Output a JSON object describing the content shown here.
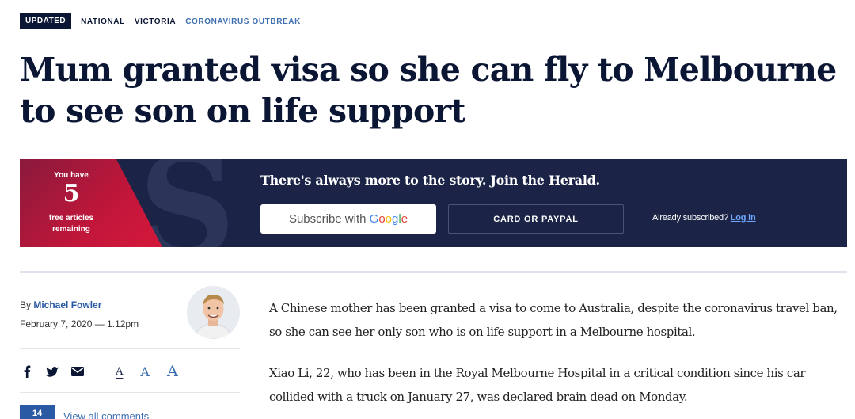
{
  "tags": {
    "updated": "UPDATED",
    "national": "NATIONAL",
    "victoria": "VICTORIA",
    "topic": "CORONAVIRUS OUTBREAK"
  },
  "headline": "Mum granted visa so she can fly to Melbourne to see son on life support",
  "paywall": {
    "you_have": "You have",
    "count": "5",
    "free_articles": "free articles",
    "remaining": "remaining",
    "pitch": "There's always more to the story. Join the Herald.",
    "subscribe_prefix": "Subscribe with ",
    "google_word": "Google",
    "card_button": "CARD OR PAYPAL",
    "already_text": "Already subscribed?",
    "login_link": "Log in"
  },
  "article": {
    "by": "By ",
    "author": "Michael Fowler",
    "date": "February 7, 2020 — 1.12pm",
    "paragraphs": [
      "A Chinese mother has been granted a visa to come to Australia, despite the coronavirus travel ban, so she can see her only son who is on life support in a Melbourne hospital.",
      "Xiao Li, 22, who has been in the Royal Melbourne Hospital in a critical condition since his car collided with a truck on January 27, was declared brain dead on Monday."
    ]
  },
  "tools": {
    "font_small": "A",
    "font_medium": "A",
    "font_large": "A",
    "comment_count": "14",
    "comments_link": "View all comments"
  },
  "icons": [
    "facebook-icon",
    "twitter-icon",
    "email-icon"
  ],
  "colors": {
    "navy": "#0a1633",
    "banner": "#1b2446",
    "accent_blue": "#3d6fb0",
    "red": "#c1163a"
  }
}
